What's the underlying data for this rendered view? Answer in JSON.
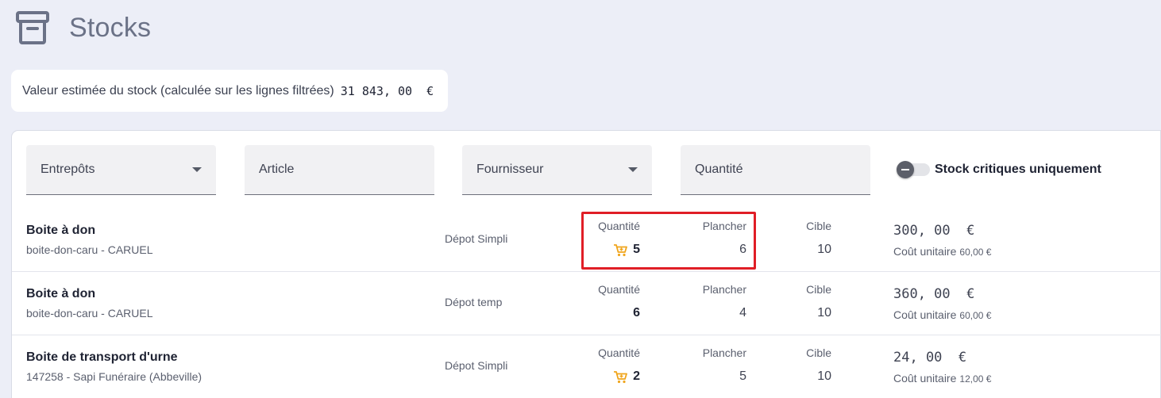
{
  "page": {
    "title": "Stocks",
    "icon": "archive-box-icon"
  },
  "summary": {
    "label": "Valeur estimée du stock (calculée sur les lignes filtrées)",
    "value": "31 843, 00  €"
  },
  "filters": {
    "warehouses": "Entrepôts",
    "article": "Article",
    "supplier": "Fournisseur",
    "quantity": "Quantité",
    "critical_toggle_label": "Stock critiques uniquement",
    "critical_toggle_on": false
  },
  "columns": {
    "quantity": "Quantité",
    "floor": "Plancher",
    "target": "Cible",
    "unit_cost": "Coût unitaire"
  },
  "rows": [
    {
      "name": "Boite à don",
      "ref": "boite-don-caru - CARUEL",
      "depot": "Dépot Simpli",
      "quantity": "5",
      "low_stock": true,
      "floor": "6",
      "target": "10",
      "total": "300, 00  €",
      "unit_cost": "60,00 €"
    },
    {
      "name": "Boite à don",
      "ref": "boite-don-caru - CARUEL",
      "depot": "Dépot temp",
      "quantity": "6",
      "low_stock": false,
      "floor": "4",
      "target": "10",
      "total": "360, 00  €",
      "unit_cost": "60,00 €"
    },
    {
      "name": "Boite de transport d'urne",
      "ref": "147258 - Sapi Funéraire (Abbeville)",
      "depot": "Dépot Simpli",
      "quantity": "2",
      "low_stock": true,
      "floor": "5",
      "target": "10",
      "total": "24, 00  €",
      "unit_cost": "12,00 €"
    }
  ],
  "colors": {
    "background": "#eceef7",
    "cart_icon": "#f0a51c",
    "highlight": "#e01e26"
  }
}
